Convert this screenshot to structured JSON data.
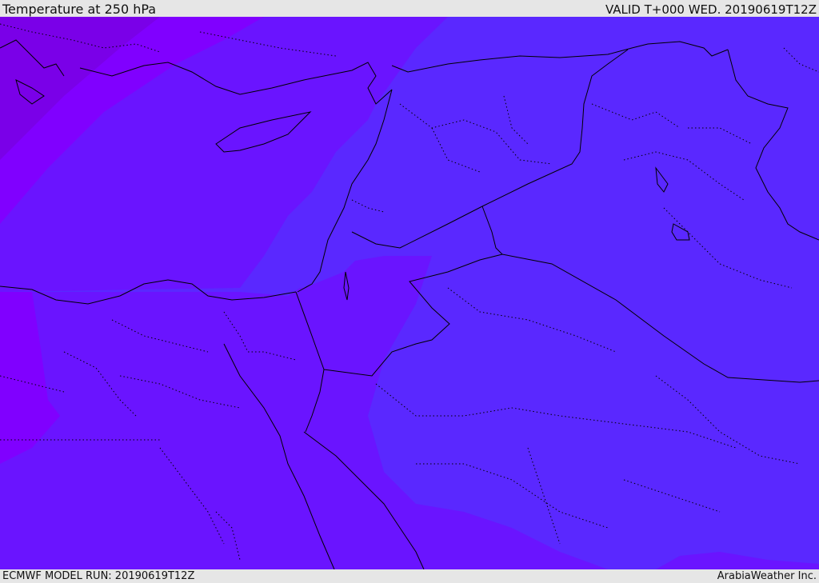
{
  "header": {
    "title": "Temperature at 250 hPa",
    "valid": "VALID T+000 WED. 20190619T12Z"
  },
  "footer": {
    "model_run": "ECMWF MODEL RUN: 20190619T12Z",
    "credit": "ArabiaWeather Inc."
  },
  "colors": {
    "background_bar": "#e6e6e6",
    "field_base": "#5a28ff",
    "field_violet": "#6a14ff",
    "field_purple": "#8000ff",
    "field_deep": "#7a00e8",
    "borders": "#000000"
  }
}
